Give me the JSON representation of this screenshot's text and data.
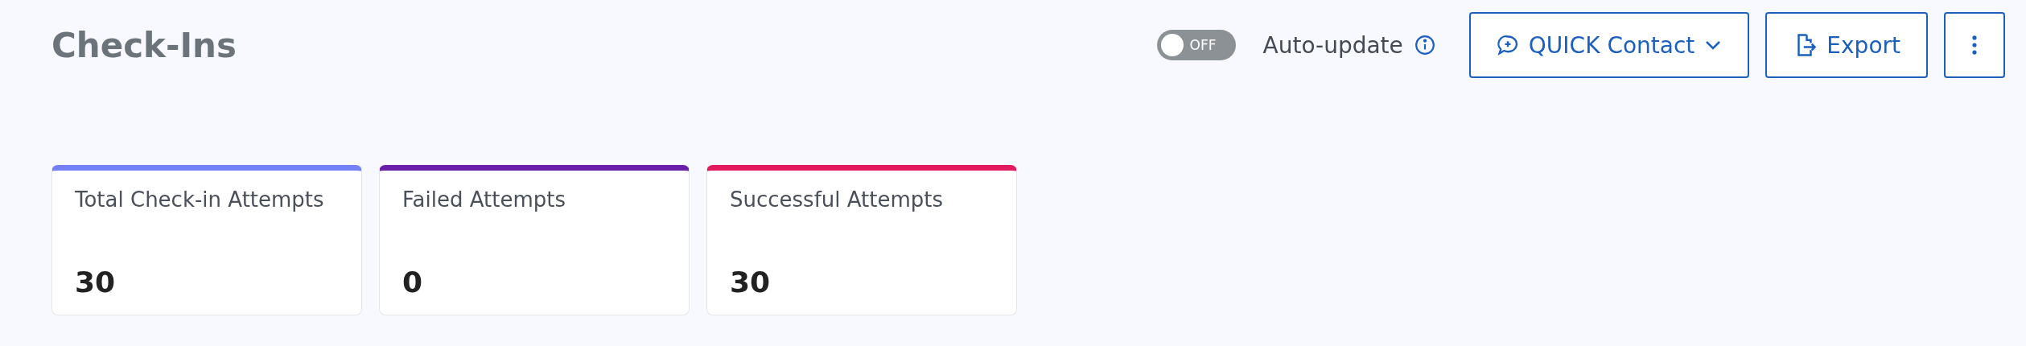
{
  "header": {
    "title": "Check-Ins",
    "auto_update": {
      "on": false,
      "toggle_label": "OFF",
      "label": "Auto-update"
    },
    "buttons": [
      {
        "kind": "contact",
        "label": "QUICK Contact"
      },
      {
        "kind": "export",
        "label": "Export"
      },
      {
        "kind": "more"
      }
    ]
  },
  "stats": [
    {
      "label": "Total Check-in Attempts",
      "value": "30",
      "color": "#7380f6"
    },
    {
      "label": "Failed Attempts",
      "value": "0",
      "color": "#6a1fa9"
    },
    {
      "label": "Successful Attempts",
      "value": "30",
      "color": "#e31a5e"
    }
  ]
}
